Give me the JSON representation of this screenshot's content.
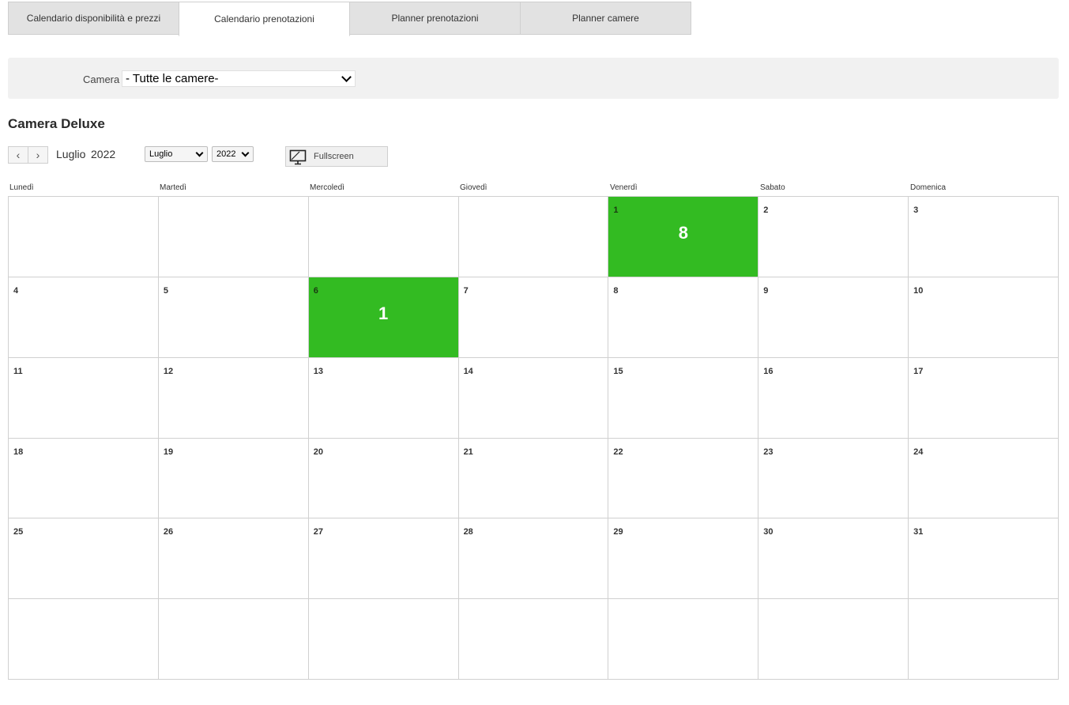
{
  "tabs": [
    {
      "label": "Calendario disponibilità e prezzi",
      "active": false
    },
    {
      "label": "Calendario prenotazioni",
      "active": true
    },
    {
      "label": "Planner prenotazioni",
      "active": false
    },
    {
      "label": "Planner camere",
      "active": false
    }
  ],
  "filter": {
    "label": "Camera",
    "selected": "- Tutte le camere-"
  },
  "room_title": "Camera Deluxe",
  "toolbar": {
    "prev": "‹",
    "next": "›",
    "month": "Luglio",
    "year": "2022",
    "month_select": "Luglio",
    "year_select": "2022",
    "fullscreen_label": "Fullscreen"
  },
  "weekdays": [
    "Lunedì",
    "Martedì",
    "Mercoledì",
    "Giovedì",
    "Venerdì",
    "Sabato",
    "Domenica"
  ],
  "cells": [
    {
      "day": "",
      "count": ""
    },
    {
      "day": "",
      "count": ""
    },
    {
      "day": "",
      "count": ""
    },
    {
      "day": "",
      "count": ""
    },
    {
      "day": "1",
      "count": "8",
      "booked": true
    },
    {
      "day": "2",
      "count": ""
    },
    {
      "day": "3",
      "count": ""
    },
    {
      "day": "4",
      "count": ""
    },
    {
      "day": "5",
      "count": ""
    },
    {
      "day": "6",
      "count": "1",
      "booked": true
    },
    {
      "day": "7",
      "count": ""
    },
    {
      "day": "8",
      "count": ""
    },
    {
      "day": "9",
      "count": ""
    },
    {
      "day": "10",
      "count": ""
    },
    {
      "day": "11",
      "count": ""
    },
    {
      "day": "12",
      "count": ""
    },
    {
      "day": "13",
      "count": ""
    },
    {
      "day": "14",
      "count": ""
    },
    {
      "day": "15",
      "count": ""
    },
    {
      "day": "16",
      "count": ""
    },
    {
      "day": "17",
      "count": ""
    },
    {
      "day": "18",
      "count": ""
    },
    {
      "day": "19",
      "count": ""
    },
    {
      "day": "20",
      "count": ""
    },
    {
      "day": "21",
      "count": ""
    },
    {
      "day": "22",
      "count": ""
    },
    {
      "day": "23",
      "count": ""
    },
    {
      "day": "24",
      "count": ""
    },
    {
      "day": "25",
      "count": ""
    },
    {
      "day": "26",
      "count": ""
    },
    {
      "day": "27",
      "count": ""
    },
    {
      "day": "28",
      "count": ""
    },
    {
      "day": "29",
      "count": ""
    },
    {
      "day": "30",
      "count": ""
    },
    {
      "day": "31",
      "count": ""
    },
    {
      "day": "",
      "count": ""
    },
    {
      "day": "",
      "count": ""
    },
    {
      "day": "",
      "count": ""
    },
    {
      "day": "",
      "count": ""
    },
    {
      "day": "",
      "count": ""
    },
    {
      "day": "",
      "count": ""
    },
    {
      "day": "",
      "count": ""
    }
  ],
  "colors": {
    "booked": "#33bb22"
  },
  "icons": {
    "fullscreen": "monitor-icon"
  }
}
